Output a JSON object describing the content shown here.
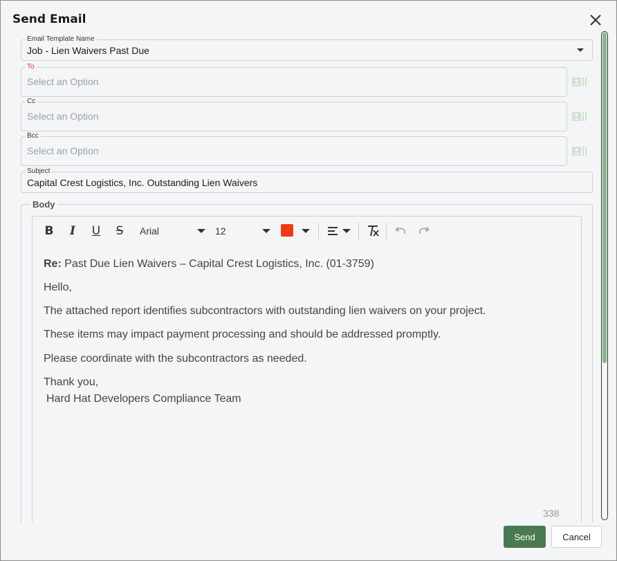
{
  "dialog": {
    "title": "Send Email"
  },
  "template": {
    "label": "Email Template Name",
    "value": "Job - Lien Waivers Past Due"
  },
  "to": {
    "label": "To",
    "placeholder": "Select an Option"
  },
  "cc": {
    "label": "Cc",
    "placeholder": "Select an Option"
  },
  "bcc": {
    "label": "Bcc",
    "placeholder": "Select an Option"
  },
  "subject": {
    "label": "Subject",
    "value": "Capital Crest Logistics, Inc. Outstanding Lien Waivers"
  },
  "body": {
    "legend": "Body",
    "toolbar": {
      "bold": "B",
      "italic": "I",
      "underline": "U",
      "strike": "S",
      "font": "Arial",
      "size": "12",
      "text_color": "#f03a17"
    },
    "content": {
      "re_label": "Re:",
      "re_text": " Past Due Lien Waivers – Capital Crest Logistics, Inc. (01-3759)",
      "greeting": "Hello,",
      "line1": "The attached report identifies subcontractors with outstanding lien waivers on your project.",
      "line2": "These items may impact payment processing and should be addressed promptly.",
      "line3": "Please coordinate with the subcontractors as needed.",
      "closing": "Thank you,",
      "signature": "Hard Hat Developers Compliance Team"
    },
    "char_count": "338"
  },
  "actions": {
    "send": "Send",
    "cancel": "Cancel"
  },
  "colors": {
    "primary": "#4a7a52",
    "accent_light": "#8bb58f",
    "required": "#d23a3a"
  },
  "icons": {
    "close": "close-icon",
    "contact": "contact-card-icon"
  }
}
